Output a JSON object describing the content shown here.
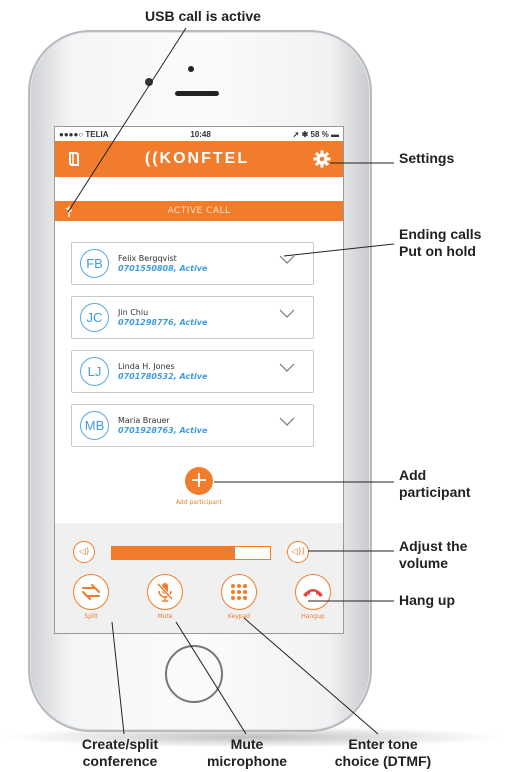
{
  "callouts": {
    "usb": "USB call is active",
    "settings": "Settings",
    "ending_line1": "Ending calls",
    "ending_line2": "Put on hold",
    "add_line1": "Add",
    "add_line2": "participant",
    "volume_line1": "Adjust the",
    "volume_line2": "volume",
    "hangup": "Hang up",
    "split_line1": "Create/split",
    "split_line2": "conference",
    "mute_line1": "Mute",
    "mute_line2": "microphone",
    "tone_line1": "Enter tone",
    "tone_line2": "choice (DTMF)"
  },
  "status": {
    "carrier": "●●●●○ TELIA",
    "time": "10:48",
    "battery": "58 %"
  },
  "app": {
    "brand": "((KONFTEL",
    "banner": "ACTIVE CALL"
  },
  "participants": [
    {
      "initials": "FB",
      "name": "Felix Bergqvist",
      "detail": "0701550808, Active"
    },
    {
      "initials": "JC",
      "name": "Jin Chiu",
      "detail": "0701298776, Active"
    },
    {
      "initials": "LJ",
      "name": "Linda H. Jones",
      "detail": "0701780532, Active"
    },
    {
      "initials": "MB",
      "name": "Maria Brauer",
      "detail": "0701928763, Active"
    }
  ],
  "add": {
    "label": "Add participant"
  },
  "volume": {
    "level": 0.78
  },
  "controls": {
    "split": "Split",
    "mute": "Mute",
    "keypad": "Keypad",
    "hangup": "Hangup"
  },
  "colors": {
    "accent": "#f07c2c",
    "contact": "#3f9be0"
  },
  "icons": [
    "usb-icon",
    "settings-gear-icon",
    "book-icon",
    "chevron-down-icon",
    "plus-icon",
    "volume-down-icon",
    "volume-up-icon",
    "split-arrows-icon",
    "microphone-muted-icon",
    "keypad-icon",
    "phone-hangup-icon"
  ]
}
